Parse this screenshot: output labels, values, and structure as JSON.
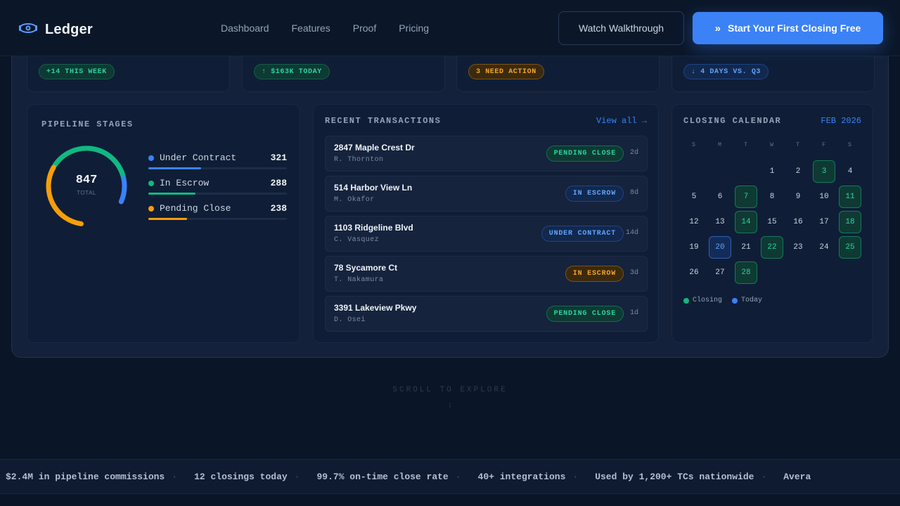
{
  "nav": {
    "brand": "Ledger",
    "links": [
      "Dashboard",
      "Features",
      "Proof",
      "Pricing"
    ],
    "secondary_cta": "Watch Walkthrough",
    "primary_cta": "Start Your First Closing Free",
    "primary_cta_icon": "double-chevron-right-icon"
  },
  "stats": [
    {
      "badge": "+14 THIS WEEK",
      "tone": "green"
    },
    {
      "badge": "↑ $163K TODAY",
      "tone": "green"
    },
    {
      "badge": "3 NEED ACTION",
      "tone": "amber"
    },
    {
      "badge": "↓ 4 DAYS VS. Q3",
      "tone": "blue"
    }
  ],
  "pipeline": {
    "title": "PIPELINE STAGES",
    "total": "847",
    "total_label": "TOTAL",
    "stages": [
      {
        "label": "Under Contract",
        "value": "321",
        "share": 0.379,
        "color": "#3b82f6"
      },
      {
        "label": "In Escrow",
        "value": "288",
        "share": 0.34,
        "color": "#10b981"
      },
      {
        "label": "Pending Close",
        "value": "238",
        "share": 0.281,
        "color": "#f59e0b"
      }
    ]
  },
  "transactions": {
    "title": "RECENT TRANSACTIONS",
    "view_all": "View all →",
    "rows": [
      {
        "address": "2847 Maple Crest Dr",
        "agent": "R. Thornton",
        "status": "PENDING CLOSE",
        "tone": "green",
        "age": "2d"
      },
      {
        "address": "514 Harbor View Ln",
        "agent": "M. Okafor",
        "status": "IN ESCROW",
        "tone": "blue",
        "age": "8d"
      },
      {
        "address": "1103 Ridgeline Blvd",
        "agent": "C. Vasquez",
        "status": "UNDER CONTRACT",
        "tone": "blue",
        "age": "14d"
      },
      {
        "address": "78 Sycamore Ct",
        "agent": "T. Nakamura",
        "status": "IN ESCROW",
        "tone": "amber",
        "age": "3d"
      },
      {
        "address": "3391 Lakeview Pkwy",
        "agent": "D. Osei",
        "status": "PENDING CLOSE",
        "tone": "green",
        "age": "1d"
      }
    ]
  },
  "calendar": {
    "title": "CLOSING CALENDAR",
    "month": "FEB 2026",
    "weekdays": [
      "S",
      "M",
      "T",
      "W",
      "T",
      "F",
      "S"
    ],
    "first_weekday": 0,
    "days_in_month": 28,
    "closing_days": [
      3,
      7,
      11,
      14,
      18,
      22,
      25,
      28
    ],
    "today": 20,
    "legend_closing": "Closing",
    "legend_today": "Today"
  },
  "scroll_hint": "SCROLL TO EXPLORE",
  "scroll_arrow": "↓",
  "ticker": [
    "$2.4M in pipeline commissions",
    "12 closings today",
    "99.7% on-time close rate",
    "40+ integrations",
    "Used by 1,200+ TCs nationwide",
    "Avera"
  ],
  "colors": {
    "accent": "#3b82f6",
    "green": "#2dd4a0",
    "amber": "#f5a524",
    "background": "#0a1628"
  }
}
